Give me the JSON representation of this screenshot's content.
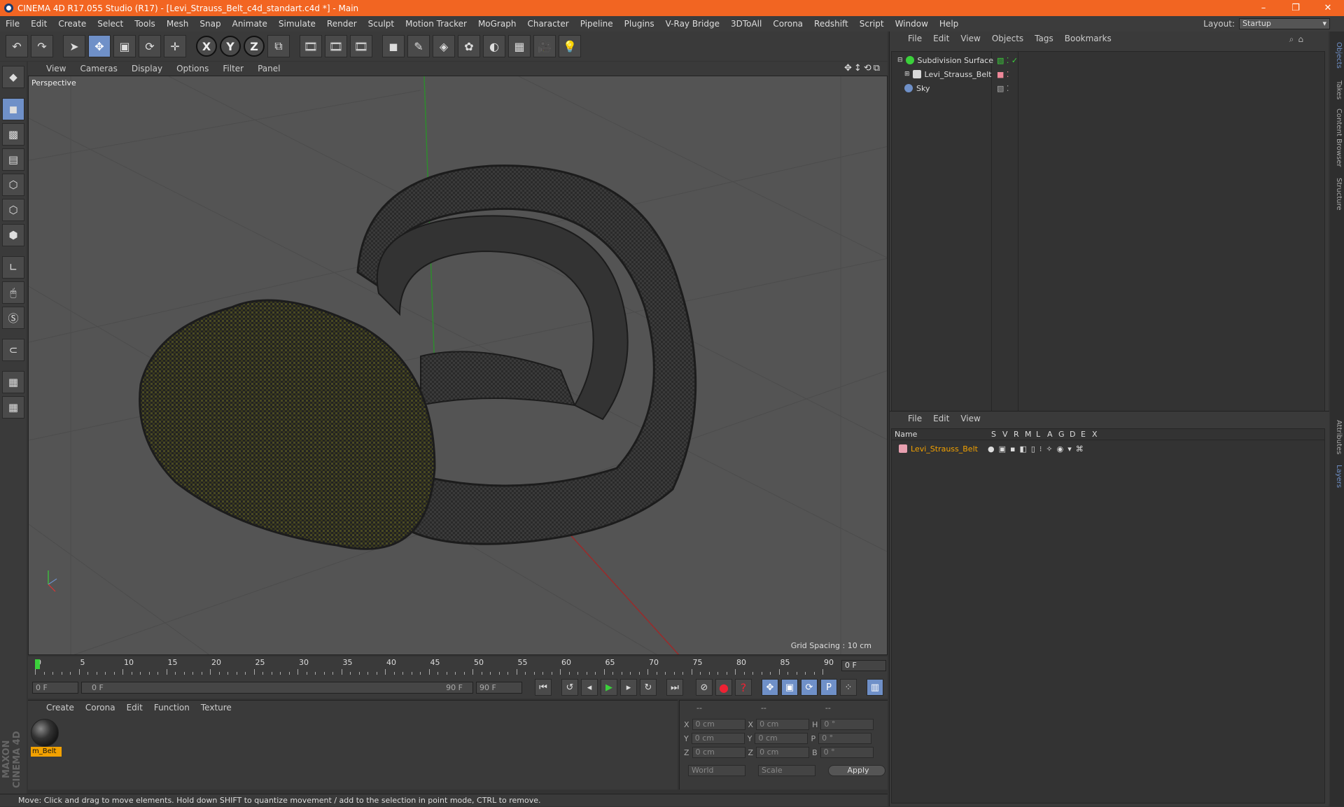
{
  "window": {
    "title": "CINEMA 4D R17.055 Studio (R17) - [Levi_Strauss_Belt_c4d_standart.c4d *] - Main",
    "min": "–",
    "max": "❐",
    "close": "✕"
  },
  "menubar": {
    "items": [
      "File",
      "Edit",
      "Create",
      "Select",
      "Tools",
      "Mesh",
      "Snap",
      "Animate",
      "Simulate",
      "Render",
      "Sculpt",
      "Motion Tracker",
      "MoGraph",
      "Character",
      "Pipeline",
      "Plugins",
      "V-Ray Bridge",
      "3DToAll",
      "Corona",
      "Redshift",
      "Script",
      "Window",
      "Help"
    ],
    "layout_label": "Layout:",
    "layout_value": "Startup"
  },
  "viewport": {
    "menu": [
      "View",
      "Cameras",
      "Display",
      "Options",
      "Filter",
      "Panel"
    ],
    "name": "Perspective",
    "grid_spacing": "Grid Spacing : 10 cm",
    "nav_icons": "✥↕⟲⧉"
  },
  "timeline": {
    "labels": [
      "0",
      "5",
      "10",
      "15",
      "20",
      "25",
      "30",
      "35",
      "40",
      "45",
      "50",
      "55",
      "60",
      "65",
      "70",
      "75",
      "80",
      "85",
      "90"
    ],
    "frame": "0 F"
  },
  "transport": {
    "start": "0 F",
    "range_start": "0 F",
    "range_end": "90 F",
    "end": "90 F"
  },
  "materials": {
    "menu": [
      "Create",
      "Corona",
      "Edit",
      "Function",
      "Texture"
    ],
    "items": [
      {
        "name": "m_Belt"
      }
    ]
  },
  "coords": {
    "h1": "--",
    "h2": "--",
    "h3": "--",
    "rows": [
      {
        "a": "X",
        "v1": "0 cm",
        "b": "X",
        "v2": "0 cm",
        "c": "H",
        "v3": "0 °"
      },
      {
        "a": "Y",
        "v1": "0 cm",
        "b": "Y",
        "v2": "0 cm",
        "c": "P",
        "v3": "0 °"
      },
      {
        "a": "Z",
        "v1": "0 cm",
        "b": "Z",
        "v2": "0 cm",
        "c": "B",
        "v3": "0 °"
      }
    ],
    "world": "World",
    "scale": "Scale",
    "apply": "Apply"
  },
  "objects": {
    "menu": [
      "File",
      "Edit",
      "View",
      "Objects",
      "Tags",
      "Bookmarks"
    ],
    "items": [
      {
        "name": "Subdivision Surface",
        "color": "#3bd13b"
      },
      {
        "name": "Levi_Strauss_Belt",
        "color": "#d8d8d8"
      },
      {
        "name": "Sky",
        "color": "#6f90c8"
      }
    ]
  },
  "layers": {
    "menu": [
      "File",
      "Edit",
      "View"
    ],
    "header": {
      "name": "Name",
      "cols": [
        "S",
        "V",
        "R",
        "M",
        "L",
        "A",
        "G",
        "D",
        "E",
        "X"
      ]
    },
    "items": [
      {
        "name": "Levi_Strauss_Belt",
        "color": "#f2a100"
      }
    ]
  },
  "sidetabs": [
    "Objects",
    "Takes",
    "Content Browser",
    "Structure",
    "Attributes",
    "Layers"
  ],
  "status": "Move: Click and drag to move elements. Hold down SHIFT to quantize movement / add to the selection in point mode, CTRL to remove.",
  "brand": "MAXON CINEMA 4D"
}
